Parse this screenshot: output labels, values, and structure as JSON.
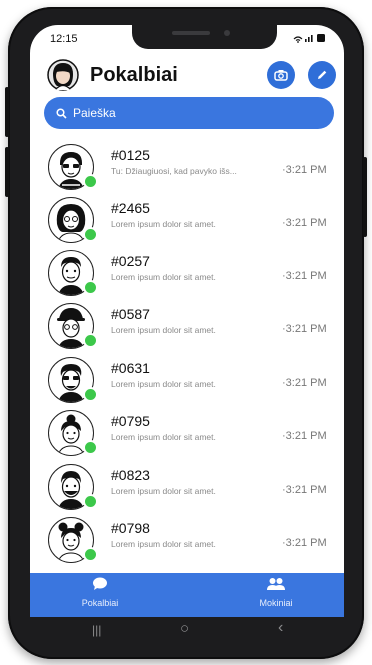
{
  "status": {
    "time": "12:15"
  },
  "header": {
    "title": "Pokalbiai",
    "camera_icon": "camera-icon",
    "edit_icon": "pencil-icon"
  },
  "search": {
    "label": "Paieška"
  },
  "chats": [
    {
      "name": "#0125",
      "preview": "Tu: Džiaugiuosi, kad pavyko išs...",
      "time": "·3:21 PM"
    },
    {
      "name": "#2465",
      "preview": "Lorem ipsum dolor sit amet.",
      "time": "·3:21 PM"
    },
    {
      "name": "#0257",
      "preview": "Lorem ipsum dolor sit amet.",
      "time": "·3:21 PM"
    },
    {
      "name": "#0587",
      "preview": "Lorem ipsum dolor sit amet.",
      "time": "·3:21 PM"
    },
    {
      "name": "#0631",
      "preview": "Lorem ipsum dolor sit amet.",
      "time": "·3:21 PM"
    },
    {
      "name": "#0795",
      "preview": "Lorem ipsum dolor sit amet.",
      "time": "·3:21 PM"
    },
    {
      "name": "#0823",
      "preview": "Lorem ipsum dolor sit amet.",
      "time": "·3:21 PM"
    },
    {
      "name": "#0798",
      "preview": "Lorem ipsum dolor sit amet.",
      "time": "·3:21 PM"
    }
  ],
  "tabs": [
    {
      "label": "Pokalbiai",
      "icon": "chat-bubble-icon"
    },
    {
      "label": "Mokiniai",
      "icon": "people-icon"
    }
  ],
  "nav": {
    "recents": "|||",
    "home": "○",
    "back": "‹"
  },
  "colors": {
    "accent": "#3a76df",
    "online": "#3cc84a"
  }
}
